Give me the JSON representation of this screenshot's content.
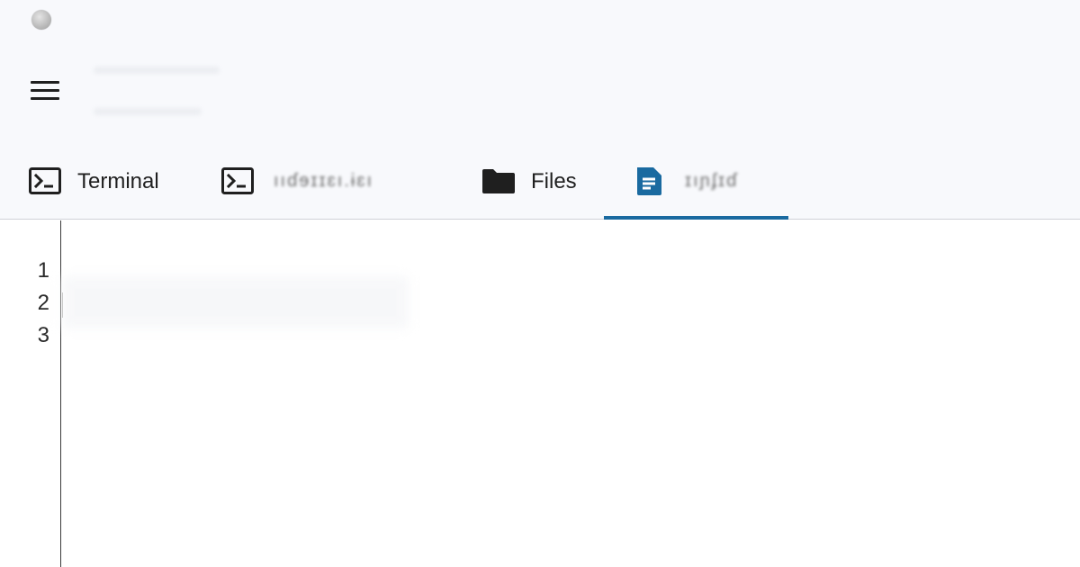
{
  "header": {
    "menu_icon": "hamburger-menu-icon",
    "status_icon": "status-dot-icon"
  },
  "tabs": [
    {
      "label": "Terminal",
      "icon": "terminal-icon",
      "active": false
    },
    {
      "label": "ııɗɘɪɪɛı.ɨɛı",
      "icon": "terminal-icon",
      "active": false
    },
    {
      "label": "Files",
      "icon": "folder-icon",
      "active": false
    },
    {
      "label": "ɪıɲʄɪɗ",
      "icon": "document-icon",
      "active": true
    }
  ],
  "editor": {
    "line_numbers": [
      "1",
      "2",
      "3"
    ]
  },
  "colors": {
    "accent": "#1a6aa0",
    "header_bg": "#f8f9fc",
    "text": "#1f1f1f"
  }
}
